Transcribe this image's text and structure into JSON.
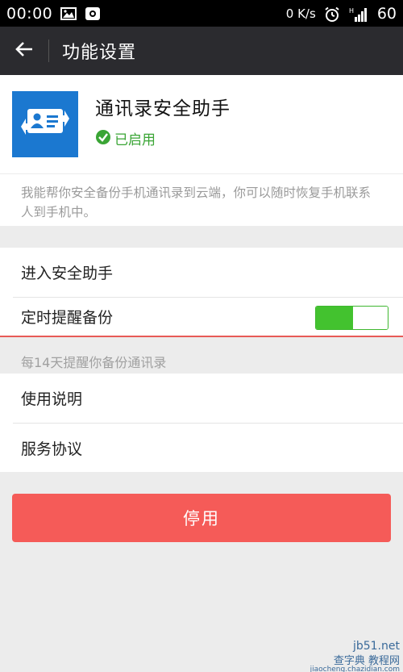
{
  "status_bar": {
    "time": "00:00",
    "net_speed": "0 K/s",
    "signal_label": "H",
    "battery": "60",
    "icons": [
      "image-icon",
      "app-notification-icon",
      "alarm-clock-icon",
      "signal-icon"
    ]
  },
  "title_bar": {
    "back_icon": "arrow-left-icon",
    "title": "功能设置"
  },
  "app": {
    "name": "通讯录安全助手",
    "status": "已启用",
    "status_icon": "check-circle-icon",
    "logo_icon": "contacts-sync-icon",
    "logo_color": "#1b78d0"
  },
  "description": "我能帮你安全备份手机通讯录到云端，你可以随时恢复手机联系人到手机中。",
  "settings": {
    "enter_assistant": "进入安全助手",
    "scheduled_backup": "定时提醒备份",
    "scheduled_backup_enabled": true,
    "backup_hint": "每14天提醒你备份通讯录",
    "usage_guide": "使用说明",
    "service_agreement": "服务协议"
  },
  "disable_button": "停用",
  "colors": {
    "accent_green": "#43c22f",
    "danger_red": "#f55b58",
    "title_bg": "#2b2b2f"
  },
  "watermark": {
    "line1": "jb51.net",
    "line2": "查字典 教程网",
    "line3": "jiaocheng.chazidian.com"
  }
}
